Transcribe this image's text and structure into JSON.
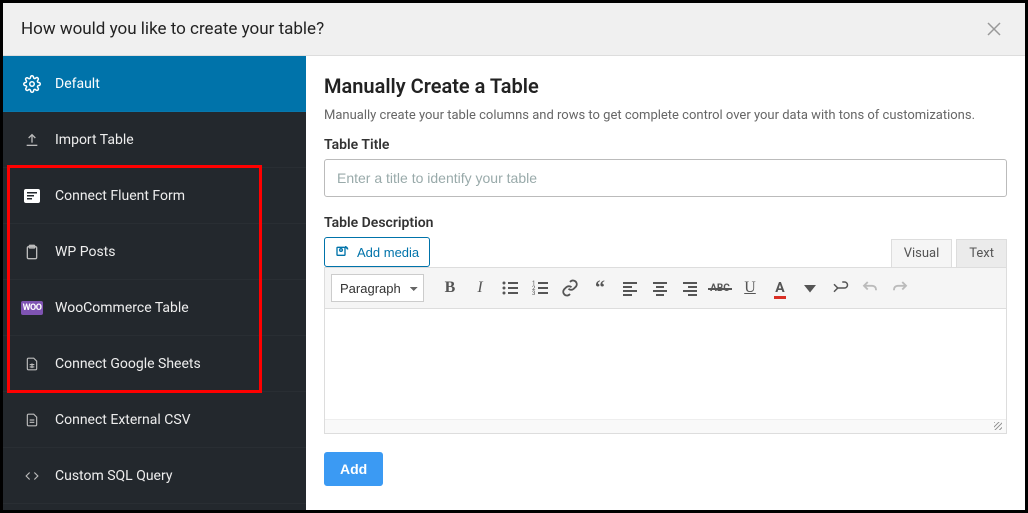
{
  "header": {
    "title": "How would you like to create your table?"
  },
  "sidebar": {
    "items": [
      {
        "label": "Default"
      },
      {
        "label": "Import Table"
      },
      {
        "label": "Connect Fluent Form"
      },
      {
        "label": "WP Posts"
      },
      {
        "label": "WooCommerce Table"
      },
      {
        "label": "Connect Google Sheets"
      },
      {
        "label": "Connect External CSV"
      },
      {
        "label": "Custom SQL Query"
      }
    ]
  },
  "content": {
    "heading": "Manually Create a Table",
    "description": "Manually create your table columns and rows to get complete control over your data with tons of customizations.",
    "title_label": "Table Title",
    "title_placeholder": "Enter a title to identify your table",
    "desc_label": "Table Description",
    "add_media_label": "Add media",
    "tabs": {
      "visual": "Visual",
      "text": "Text"
    },
    "format_select": "Paragraph",
    "add_button": "Add",
    "woo_badge": "WOO"
  }
}
